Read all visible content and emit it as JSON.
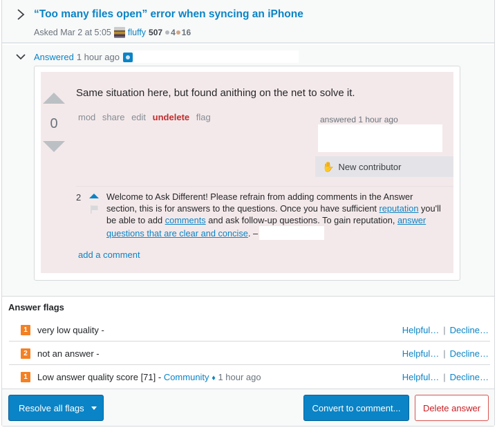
{
  "question": {
    "title": "“Too many files open” error when syncing an iPhone",
    "asked_label": "Asked Mar 2 at 5:05",
    "user": "fluffy",
    "reputation": "507",
    "silver_badges": "4",
    "bronze_badges": "16",
    "badge_colors": {
      "silver": "#b4b8bc",
      "bronze": "#d1a684"
    }
  },
  "answer": {
    "answered_link": "Answered",
    "answered_time": "1 hour ago",
    "score": "0",
    "body": "Same situation here, but found anithing on the net to solve it.",
    "menu": [
      "mod",
      "share",
      "edit",
      "undelete",
      "flag"
    ],
    "answered_label": "answered 1 hour ago",
    "new_contributor": "New contributor",
    "background_color": "#f4e9ea"
  },
  "comment": {
    "score": "2",
    "text_1": "Welcome to Ask Different! Please refrain from adding comments in the Answer section, this is for answers to the questions. Once you have sufficient ",
    "link_reputation": "reputation",
    "text_2": " you'll be able to add ",
    "link_comments": "comments",
    "text_3": " and ask follow-up questions. To gain reputation, ",
    "link_answer": "answer questions that are clear and concise",
    "text_4": ". –",
    "add_comment": "add a comment"
  },
  "flags": {
    "title": "Answer flags",
    "items": [
      {
        "count": "1",
        "text": "very low quality -",
        "user": "",
        "diamond": "",
        "time": ""
      },
      {
        "count": "2",
        "text": "not an answer -",
        "user": "",
        "diamond": "",
        "time": ""
      },
      {
        "count": "1",
        "text": "Low answer quality score [71] - ",
        "user": "Community",
        "diamond": "♦",
        "time": "1 hour ago"
      }
    ],
    "helpful_label": "Helpful…",
    "separator": "|",
    "decline_label": "Decline…"
  },
  "footer": {
    "resolve_label": "Resolve all flags",
    "convert_label": "Convert to comment...",
    "delete_label": "Delete answer"
  }
}
